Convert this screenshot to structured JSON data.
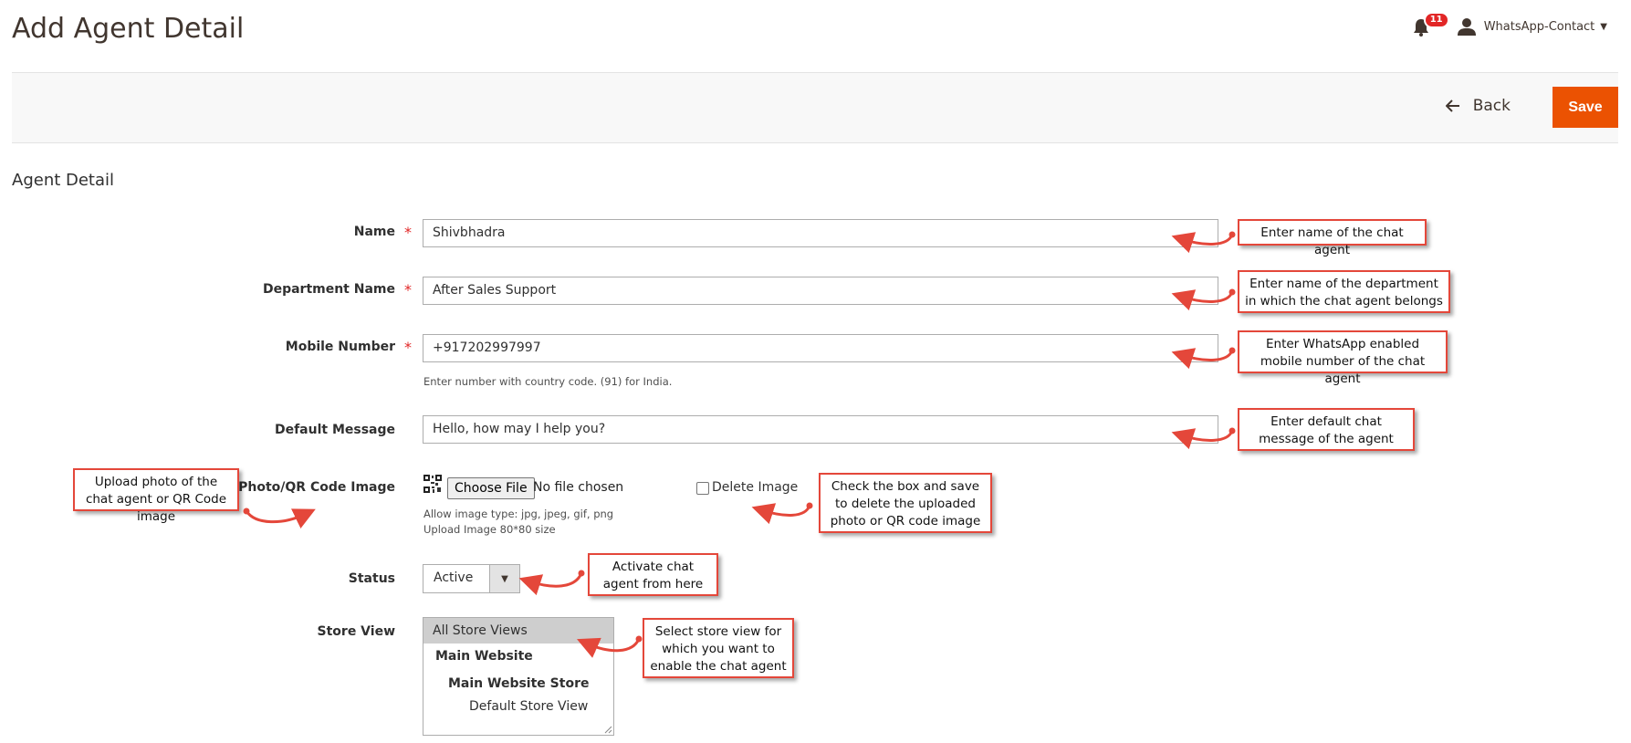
{
  "header": {
    "title": "Add Agent Detail",
    "notifications_count": "11",
    "user_name": "WhatsApp-Contact"
  },
  "action_bar": {
    "back_label": "Back",
    "save_label": "Save"
  },
  "section": {
    "title": "Agent Detail"
  },
  "form": {
    "name": {
      "label": "Name",
      "value": "Shivbhadra",
      "required": true
    },
    "department": {
      "label": "Department Name",
      "value": "After Sales Support",
      "required": true
    },
    "mobile": {
      "label": "Mobile Number",
      "value": "+917202997997",
      "required": true,
      "note": "Enter number with country code. (91) for India."
    },
    "default_message": {
      "label": "Default Message",
      "value": "Hello, how may I help you?"
    },
    "photo": {
      "label": "Photo/QR Code Image",
      "button_label": "Choose File",
      "file_status": "No file chosen",
      "delete_label": "Delete Image",
      "note_line1": "Allow image type: jpg, jpeg, gif, png",
      "note_line2": "Upload Image 80*80 size"
    },
    "status": {
      "label": "Status",
      "value": "Active"
    },
    "store_view": {
      "label": "Store View",
      "options": [
        "All Store Views",
        "Main Website",
        "Main Website Store",
        "Default Store View"
      ],
      "selected": "All Store Views"
    }
  },
  "callouts": {
    "name": "Enter name of the chat agent",
    "department": "Enter name of the department in which the chat agent belongs",
    "mobile": "Enter WhatsApp enabled mobile number of the chat agent",
    "message": "Enter default chat message of the agent",
    "upload": "Upload photo of the chat agent or QR Code image",
    "delete": "Check the box and save to delete the uploaded photo or QR code image",
    "status": "Activate chat agent from here",
    "store": "Select store view for which you want to enable the chat agent"
  },
  "colors": {
    "accent": "#eb5202",
    "callout_border": "#e4473a",
    "required": "#e22626"
  }
}
